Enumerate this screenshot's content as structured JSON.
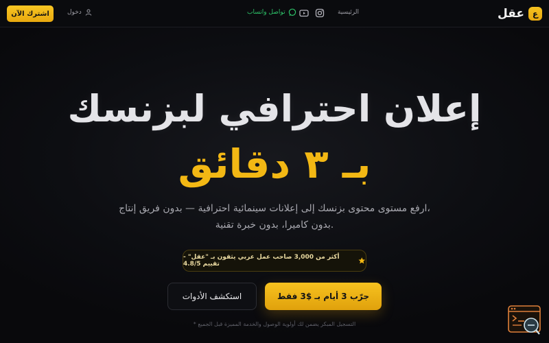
{
  "nav": {
    "logo_badge": "ع",
    "logo_text": "عقل",
    "home": "الرئيسية",
    "whatsapp": "تواصل واتساب",
    "login": "دخول",
    "subscribe": "اشترك الآن",
    "icons": [
      "instagram-icon",
      "youtube-icon",
      "whatsapp-icon",
      "user-icon"
    ]
  },
  "hero": {
    "title": "إعلان احترافي لبزنسك",
    "accent": "بـ ٣ دقائق",
    "subtitle_line1": "ارفع مستوى محتوى بزنسك إلى إعلانات سينمائية احترافية — بدون فريق إنتاج،",
    "subtitle_line2": "بدون كاميرا، بدون خبرة تقنية."
  },
  "badge": {
    "text": "أكثر من 3,000 صاحب عمل عربي يثقون بـ \"عقل\" - تقييم 4.8/5",
    "icon": "star-icon"
  },
  "cta": {
    "primary": "جرّب 3 أيام بـ $3 فقط",
    "secondary": "استكشف الأدوات"
  },
  "footnote": "* التسجيل المبكر يضمن لك أولوية الوصول والخدمة المميزة قبل الجميع",
  "colors": {
    "accent": "#f3b814",
    "background": "#0b0c10",
    "whatsapp": "#2ec56a"
  }
}
